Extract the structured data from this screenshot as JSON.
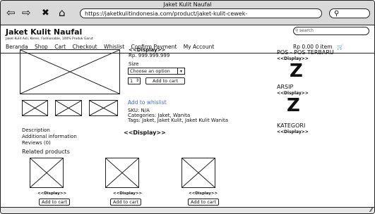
{
  "browser": {
    "window_title": "Jaket Kulit Naufal",
    "url": "https://jaketkulitindonesia.com/product/jaket-kulit-cewek-",
    "nav_icons": [
      "back-arrow-icon",
      "forward-arrow-icon",
      "close-icon",
      "home-icon",
      "search-icon"
    ]
  },
  "site": {
    "title": "Jaket Kulit Naufal",
    "tagline": "Jaket Kulit Asli, Keren, Fashionable, 100% Produk Garut",
    "search_placeholder": "search",
    "menu": [
      "Beranda",
      "Shop",
      "Cart",
      "Checkout",
      "Whislist",
      "Confirm Payment",
      "My Account"
    ],
    "cart_summary": "Rp 0.00 0 item"
  },
  "product": {
    "display_label": "<<Display>>",
    "price": "Rp. 999.999.999",
    "size_label": "Size",
    "size_select_value": "Choose an option",
    "quantity": "1",
    "add_to_cart": "Add to cart",
    "whishlist_link": "Add to whislist",
    "sku": "SKU: N/A",
    "categories": "Categories: Jaket, Wanita",
    "tags": "Tags: Jaket, Jaket Kulit, Jaket Kulit Wanita"
  },
  "tabs": [
    "Description",
    "Additional information",
    "Reviews (0)"
  ],
  "tab_display": "<<Display>>",
  "related": {
    "heading": "Related products",
    "items": [
      {
        "label": "<<Display>>",
        "button": "Add to cart"
      },
      {
        "label": "<<Display>>",
        "button": "Add to cart"
      },
      {
        "label": "<<Display>>",
        "button": "Add to cart"
      }
    ]
  },
  "sidebar": {
    "sections": [
      {
        "title": "POS - POS TERBARU",
        "display": "<<Display>>",
        "glyph": "Z"
      },
      {
        "title": "ARSIP",
        "display": "<<Display>>",
        "glyph": "Z"
      },
      {
        "title": "KATEGORI",
        "display": "<<Display>>"
      }
    ]
  }
}
